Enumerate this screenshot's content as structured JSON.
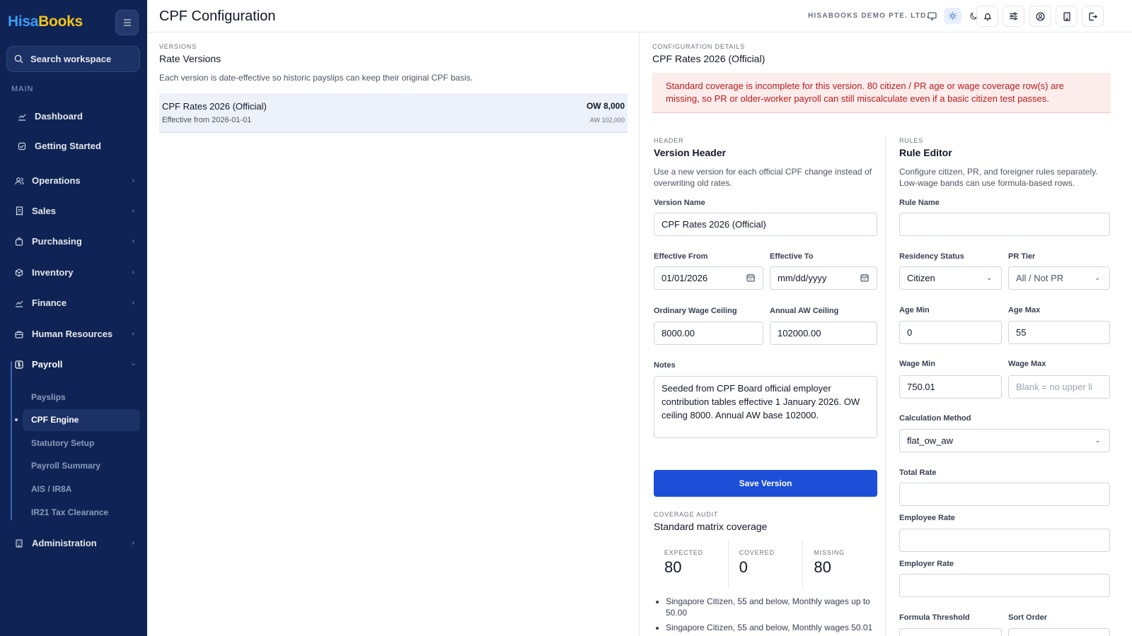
{
  "brand": {
    "part1": "Hisa",
    "part2": "Books"
  },
  "sidebar": {
    "search_placeholder": "Search workspace",
    "section_main": "MAIN",
    "items": [
      {
        "label": "Dashboard"
      },
      {
        "label": "Getting Started"
      },
      {
        "label": "Operations"
      },
      {
        "label": "Sales"
      },
      {
        "label": "Purchasing"
      },
      {
        "label": "Inventory"
      },
      {
        "label": "Finance"
      },
      {
        "label": "Human Resources"
      },
      {
        "label": "Payroll"
      },
      {
        "label": "Administration"
      }
    ],
    "payroll_sub": [
      "Payslips",
      "CPF Engine",
      "Statutory Setup",
      "Payroll Summary",
      "AIS / IR8A",
      "IR21 Tax Clearance"
    ]
  },
  "header": {
    "title": "CPF Configuration",
    "company": "HISABOOKS DEMO PTE. LTD."
  },
  "versions": {
    "eyebrow": "VERSIONS",
    "title": "Rate Versions",
    "description": "Each version is date-effective so historic payslips can keep their original CPF basis.",
    "rows": [
      {
        "name": "CPF Rates 2026 (Official)",
        "effective": "Effective from 2026-01-01",
        "ow": "OW 8,000",
        "aw": "AW 102,000"
      }
    ]
  },
  "config": {
    "eyebrow": "CONFIGURATION DETAILS",
    "title": "CPF Rates 2026 (Official)",
    "alert": "Standard coverage is incomplete for this version. 80 citizen / PR age or wage coverage row(s) are missing, so PR or older-worker payroll can still miscalculate even if a basic citizen test passes."
  },
  "header_form": {
    "eyebrow": "HEADER",
    "title": "Version Header",
    "description": "Use a new version for each official CPF change instead of overwriting old rates.",
    "version_name_label": "Version Name",
    "version_name_value": "CPF Rates 2026 (Official)",
    "effective_from_label": "Effective From",
    "effective_from_value": "01/01/2026",
    "effective_to_label": "Effective To",
    "effective_to_placeholder": "mm/dd/yyyy",
    "ow_ceiling_label": "Ordinary Wage Ceiling",
    "ow_ceiling_value": "8000.00",
    "aw_ceiling_label": "Annual AW Ceiling",
    "aw_ceiling_value": "102000.00",
    "notes_label": "Notes",
    "notes_value": "Seeded from CPF Board official employer contribution tables effective 1 January 2026. OW ceiling 8000. Annual AW base 102000.",
    "save_label": "Save Version"
  },
  "coverage": {
    "eyebrow": "COVERAGE AUDIT",
    "title": "Standard matrix coverage",
    "expected_label": "EXPECTED",
    "expected_value": "80",
    "covered_label": "COVERED",
    "covered_value": "0",
    "missing_label": "MISSING",
    "missing_value": "80",
    "missing_items": [
      "Singapore Citizen, 55 and below, Monthly wages up to 50.00",
      "Singapore Citizen, 55 and below, Monthly wages 50.01"
    ]
  },
  "rules": {
    "eyebrow": "RULES",
    "title": "Rule Editor",
    "description": "Configure citizen, PR, and foreigner rules separately. Low-wage bands can use formula-based rows.",
    "rule_name_label": "Rule Name",
    "residency_label": "Residency Status",
    "residency_value": "Citizen",
    "pr_tier_label": "PR Tier",
    "pr_tier_value": "All / Not PR",
    "age_min_label": "Age Min",
    "age_min_value": "0",
    "age_max_label": "Age Max",
    "age_max_value": "55",
    "wage_min_label": "Wage Min",
    "wage_min_value": "750.01",
    "wage_max_label": "Wage Max",
    "wage_max_placeholder": "Blank = no upper li",
    "calc_method_label": "Calculation Method",
    "calc_method_value": "flat_ow_aw",
    "total_rate_label": "Total Rate",
    "employee_rate_label": "Employee Rate",
    "employer_rate_label": "Employer Rate",
    "formula_threshold_label": "Formula Threshold",
    "sort_order_label": "Sort Order"
  }
}
